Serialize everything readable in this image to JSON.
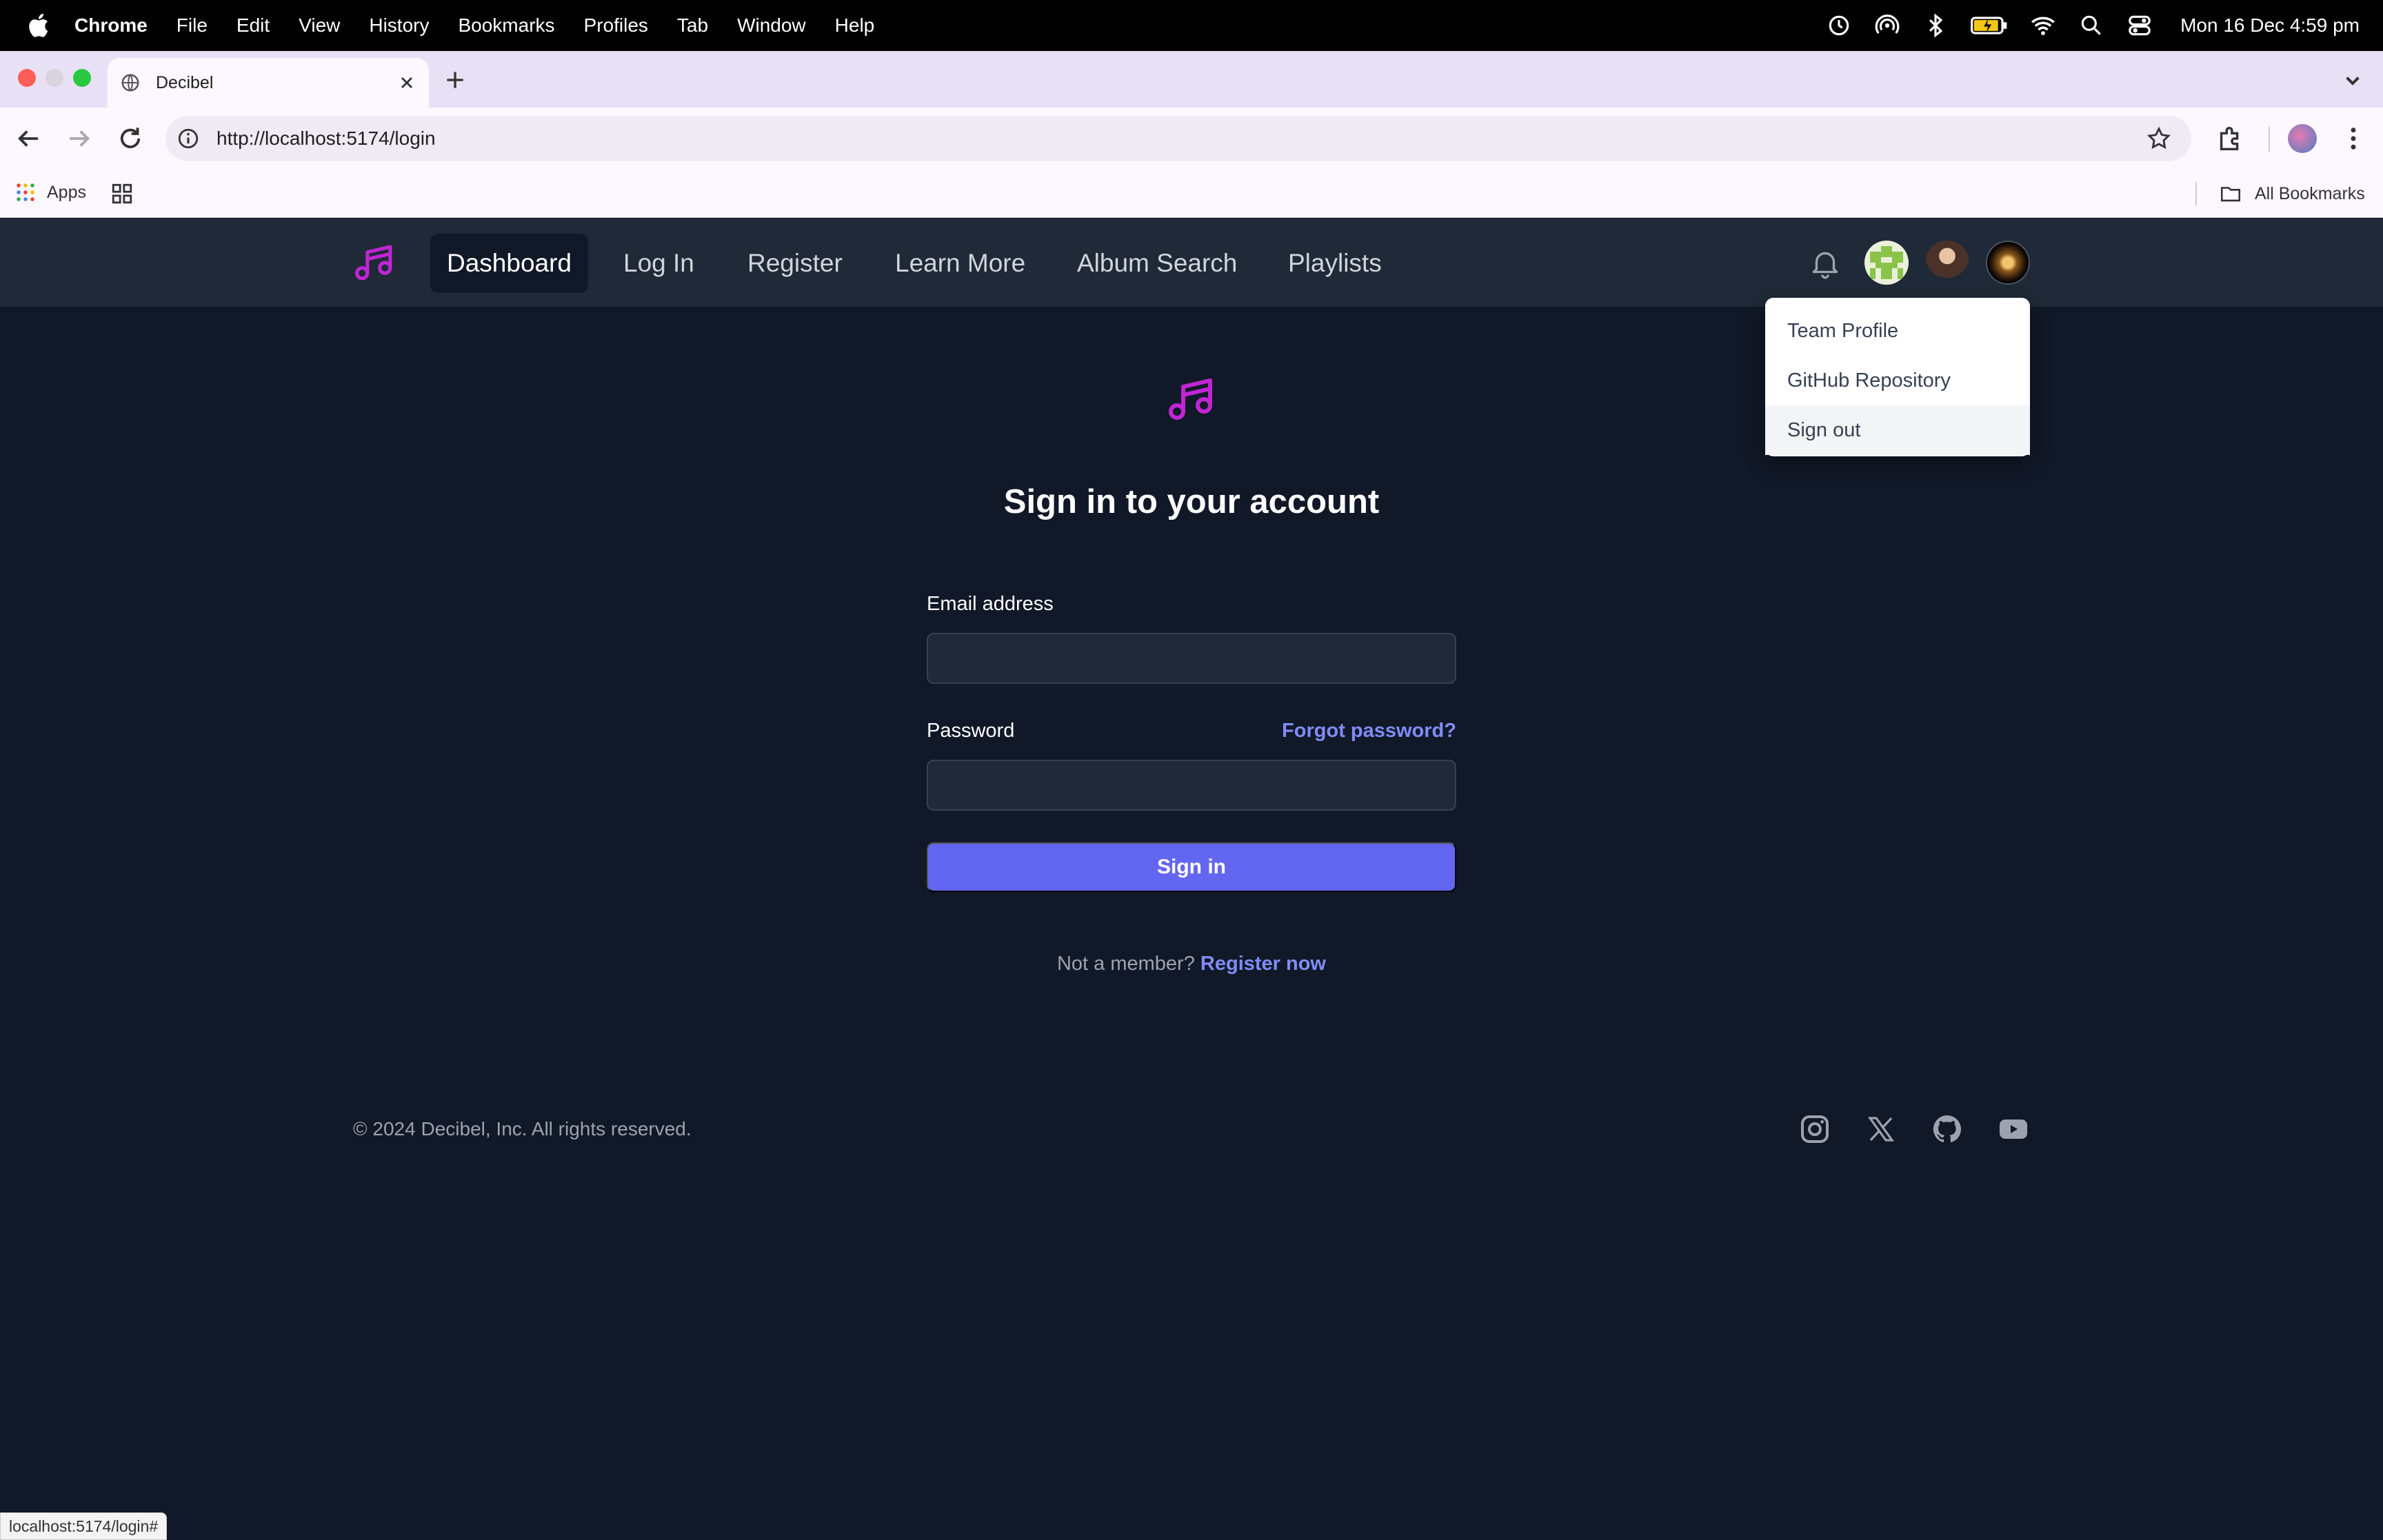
{
  "menubar": {
    "app": "Chrome",
    "menus": [
      "File",
      "Edit",
      "View",
      "History",
      "Bookmarks",
      "Profiles",
      "Tab",
      "Window",
      "Help"
    ],
    "clock": "Mon 16 Dec  4:59 pm"
  },
  "browser": {
    "tab_title": "Decibel",
    "url": "http://localhost:5174/login",
    "bookmarks": {
      "apps_label": "Apps",
      "all_bookmarks_label": "All Bookmarks"
    },
    "status_url": "localhost:5174/login#"
  },
  "nav": {
    "items": [
      "Dashboard",
      "Log In",
      "Register",
      "Learn More",
      "Album Search",
      "Playlists"
    ],
    "active": "Dashboard"
  },
  "user_menu": {
    "items": [
      "Team Profile",
      "GitHub Repository",
      "Sign out"
    ],
    "hovered": "Sign out"
  },
  "login": {
    "heading": "Sign in to your account",
    "email_label": "Email address",
    "email_value": "",
    "password_label": "Password",
    "password_value": "",
    "forgot_link": "Forgot password?",
    "submit_label": "Sign in",
    "not_member_text": "Not a member?",
    "register_link": "Register now"
  },
  "footer": {
    "copyright": "© 2024 Decibel, Inc. All rights reserved.",
    "social_icons": [
      "instagram-icon",
      "x-icon",
      "github-icon",
      "youtube-icon"
    ]
  },
  "colors": {
    "page_bg": "#111827",
    "nav_bg": "#1f2937",
    "accent": "#6366f1",
    "link": "#818cf8",
    "logo": "#c026d3"
  }
}
